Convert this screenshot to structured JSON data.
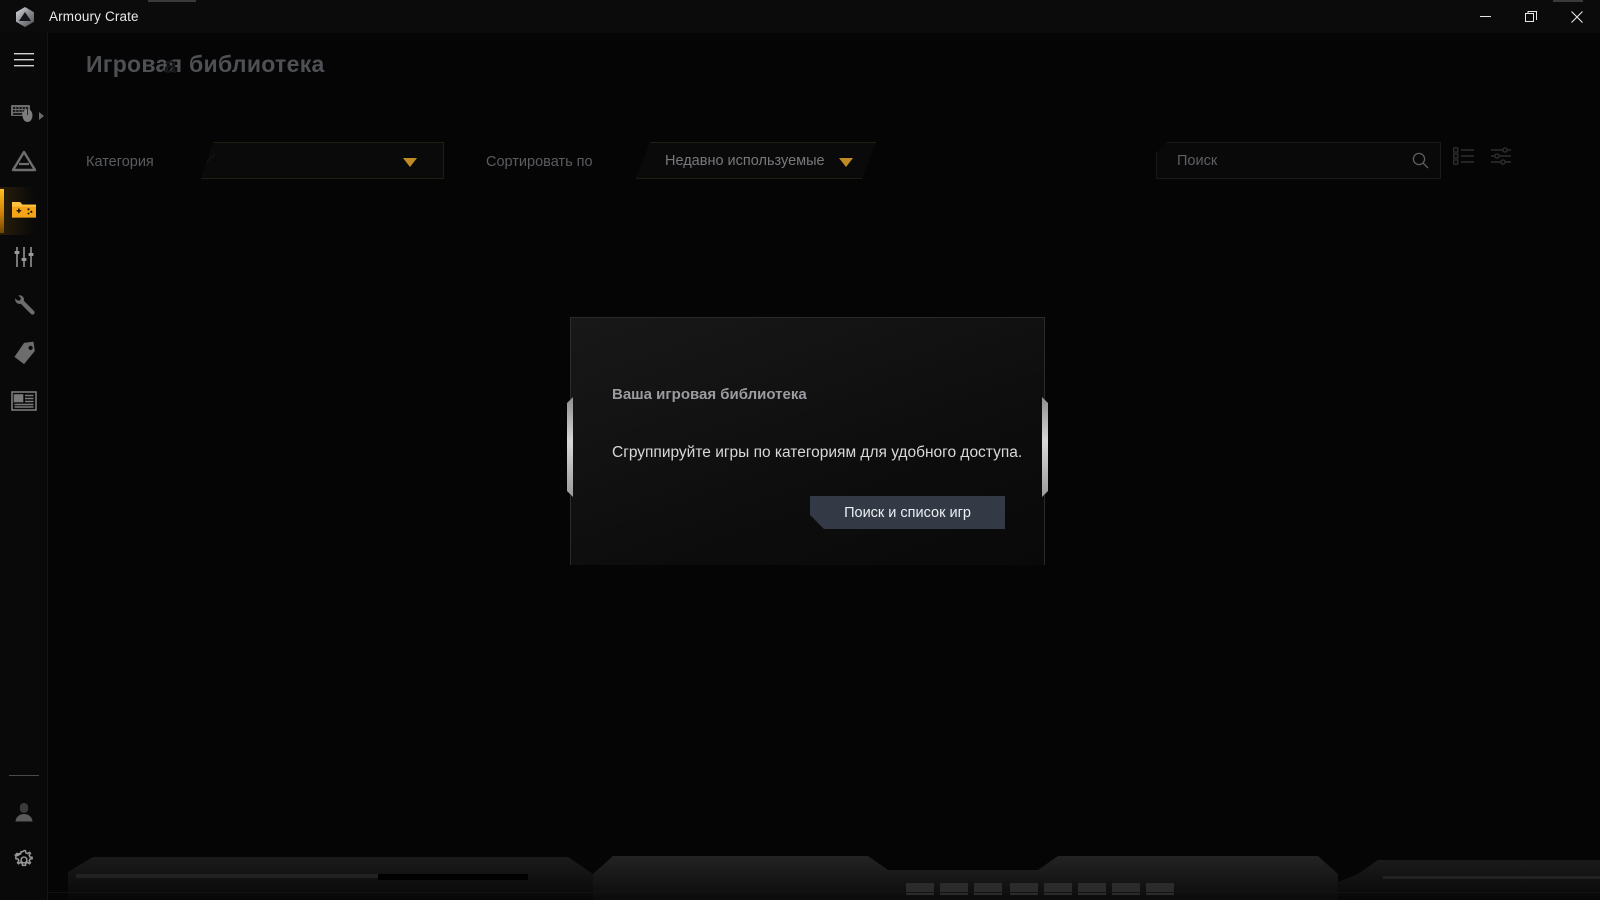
{
  "window": {
    "title": "Armoury Crate",
    "logo_icon": "armoury-crate-logo-icon",
    "minimize_label": "—",
    "restore_label": "❐",
    "close_label": "✕"
  },
  "sidebar": {
    "items": [
      {
        "id": "menu",
        "name": "hamburger-menu",
        "icon": "hamburger-icon",
        "active": false,
        "expandable": false
      },
      {
        "id": "devices",
        "name": "device-settings",
        "icon": "keyboard-mouse-icon",
        "active": false,
        "expandable": true
      },
      {
        "id": "lighting",
        "name": "aura-lighting",
        "icon": "aura-triangle-icon",
        "active": false,
        "expandable": false
      },
      {
        "id": "game-library",
        "name": "game-library",
        "icon": "game-folder-icon",
        "active": true,
        "expandable": false
      },
      {
        "id": "scenarios",
        "name": "scenario-profiles",
        "icon": "sliders-icon",
        "active": false,
        "expandable": false
      },
      {
        "id": "tools",
        "name": "tools",
        "icon": "wrench-icon",
        "active": false,
        "expandable": false
      },
      {
        "id": "deals",
        "name": "featured-deals",
        "icon": "price-tag-icon",
        "active": false,
        "expandable": false
      },
      {
        "id": "news",
        "name": "news-and-content",
        "icon": "news-panel-icon",
        "active": false,
        "expandable": false
      }
    ],
    "bottom_items": [
      {
        "id": "account",
        "name": "user-account",
        "icon": "user-icon"
      },
      {
        "id": "settings",
        "name": "app-settings",
        "icon": "gear-icon"
      }
    ]
  },
  "page": {
    "title": "Игровая библиотека",
    "title_ghost": "а"
  },
  "filters": {
    "category_label": "Категория",
    "category_value": "",
    "sort_label": "Сортировать по",
    "sort_value": "Недавно используемые",
    "caret_icon": "chevron-down-icon",
    "caret_color": "#c08b22"
  },
  "search": {
    "placeholder": "Поиск",
    "value": "",
    "icon": "search-icon"
  },
  "view_toggles": [
    {
      "id": "list-view",
      "name": "list-view-toggle",
      "icon": "list-view-icon"
    },
    {
      "id": "filter-view",
      "name": "filter-settings-toggle",
      "icon": "filter-sliders-icon"
    }
  ],
  "dialog": {
    "title": "Ваша игровая библиотека",
    "body": "Сгруппируйте игры по категориям для удобного доступа.",
    "button_label": "Поиск и список игр",
    "button_color": "#343946"
  },
  "theme": {
    "accent": "#ffb21e",
    "background": "#050505",
    "sidebar_bg": "#090909",
    "text_primary": "#d7d8da",
    "text_muted": "#5a5c60"
  }
}
